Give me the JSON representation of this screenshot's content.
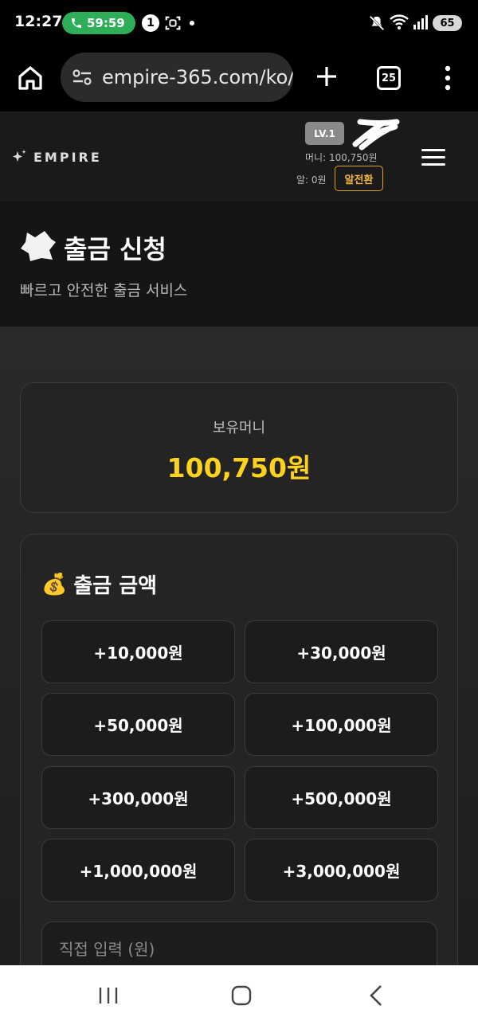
{
  "status_bar": {
    "time": "12:27",
    "call_timer": "59:59",
    "notification_badge": "1",
    "battery": "65"
  },
  "browser": {
    "url": "empire-365.com/ko/",
    "tab_count": "25"
  },
  "header": {
    "logo_text": "EMPIRE",
    "level": "LV.1",
    "money_line": "머니: 100,750원",
    "al_line": "알: 0원",
    "convert_label": "알전환"
  },
  "hero": {
    "title": "출금 신청",
    "subtitle": "빠르고 안전한 출금 서비스"
  },
  "balance": {
    "label": "보유머니",
    "value": "100,750원"
  },
  "amount": {
    "icon": "💰",
    "title": "출금 금액",
    "buttons": [
      {
        "label": "+10,000원"
      },
      {
        "label": "+30,000원"
      },
      {
        "label": "+50,000원"
      },
      {
        "label": "+100,000원"
      },
      {
        "label": "+300,000원"
      },
      {
        "label": "+500,000원"
      },
      {
        "label": "+1,000,000원"
      },
      {
        "label": "+3,000,000원"
      }
    ],
    "direct_placeholder": "직접 입력 (원)"
  },
  "colors": {
    "accent_gold": "#ffd21e",
    "convert_border": "#e0a020",
    "call_green": "#2fae5a"
  }
}
